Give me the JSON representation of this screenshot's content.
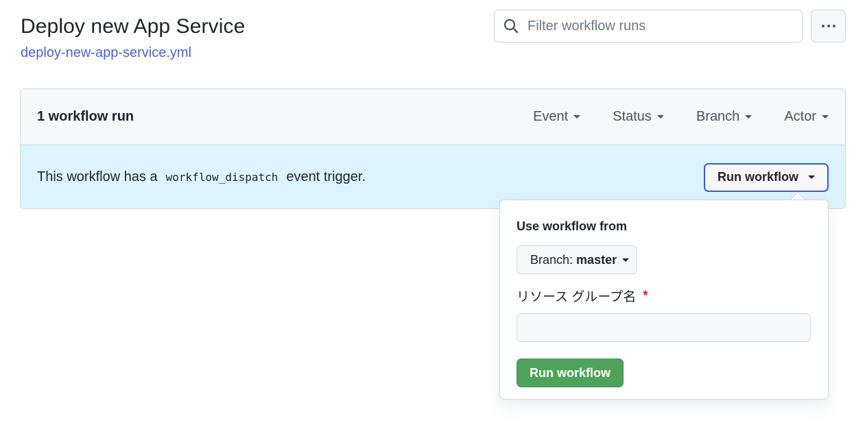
{
  "header": {
    "title": "Deploy new App Service",
    "workflow_file": "deploy-new-app-service.yml"
  },
  "search": {
    "placeholder": "Filter workflow runs",
    "value": "",
    "icon": "search-icon"
  },
  "more_button": {
    "icon": "kebab-horizontal-icon"
  },
  "runs_box": {
    "count_label": "1 workflow run",
    "filters": [
      {
        "label": "Event"
      },
      {
        "label": "Status"
      },
      {
        "label": "Branch"
      },
      {
        "label": "Actor"
      }
    ]
  },
  "banner": {
    "text_before": "This workflow has a",
    "code": "workflow_dispatch",
    "text_after": "event trigger.",
    "run_button_label": "Run workflow"
  },
  "popover": {
    "heading": "Use workflow from",
    "branch_prefix": "Branch:",
    "branch_value": "master",
    "field_label": "リソース グループ名",
    "required_marker": "*",
    "field_value": "",
    "submit_label": "Run workflow"
  },
  "colors": {
    "link": "#4a62c8",
    "banner_bg": "#ddf4ff",
    "primary_button": "#4ea25a",
    "focus_border": "#3b5bd1",
    "required": "#cf222e"
  }
}
